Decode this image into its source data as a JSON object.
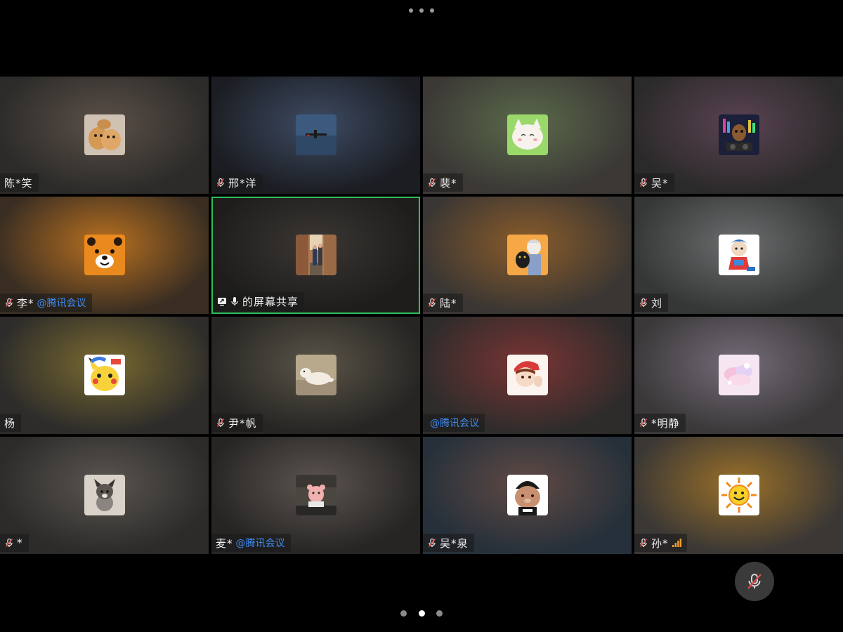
{
  "more_menu": {
    "icon": "more-dots-icon"
  },
  "tiles": [
    {
      "name": "陈*笑",
      "org": "",
      "mic": "none",
      "avatar": "cats-photo",
      "bg": [
        "#5b5048",
        "#2c2b29"
      ]
    },
    {
      "name": "邢*洋",
      "org": "",
      "mic": "muted",
      "avatar": "plane-photo",
      "bg": [
        "#3e4b63",
        "#1b1d22"
      ]
    },
    {
      "name": "裴*",
      "org": "",
      "mic": "muted",
      "avatar": "cat-cartoon",
      "bg": [
        "#5a6a4a",
        "#3b3836"
      ]
    },
    {
      "name": "吴*",
      "org": "",
      "mic": "muted",
      "avatar": "groot-dj",
      "bg": [
        "#5a4352",
        "#2b2a2a"
      ]
    },
    {
      "name": "李*",
      "org": "@腾讯会议",
      "mic": "muted",
      "avatar": "bear-orange",
      "bg": [
        "#b87020",
        "#3a2e22"
      ]
    },
    {
      "name": "的屏幕共享",
      "org": "",
      "mic": "active",
      "avatar": "street-photo",
      "bg": [
        "#3a3633",
        "#1e1d1c"
      ],
      "active": true
    },
    {
      "name": "陆*",
      "org": "",
      "mic": "muted",
      "avatar": "anime-cat",
      "bg": [
        "#8a5c2a",
        "#3a3633"
      ]
    },
    {
      "name": "刘",
      "org": "",
      "mic": "muted",
      "avatar": "mascot-blue",
      "bg": [
        "#6b6d6e",
        "#353636"
      ]
    },
    {
      "name": "杨",
      "org": "",
      "mic": "none",
      "avatar": "pikachu",
      "bg": [
        "#7a6a30",
        "#2d2c2a"
      ]
    },
    {
      "name": "尹*帆",
      "org": "",
      "mic": "muted",
      "avatar": "dog-photo",
      "bg": [
        "#5a5448",
        "#262523"
      ]
    },
    {
      "name": "",
      "org": "@腾讯会议",
      "mic": "none",
      "avatar": "anime-boy",
      "bg": [
        "#7a3434",
        "#2e2c2b"
      ]
    },
    {
      "name": "*明静",
      "org": "",
      "mic": "muted",
      "avatar": "pink-art",
      "bg": [
        "#746c78",
        "#3a3839"
      ]
    },
    {
      "name": "*",
      "org": "",
      "mic": "muted",
      "avatar": "puppy-photo",
      "bg": [
        "#5a5550",
        "#2c2b2a"
      ]
    },
    {
      "name": "麦*",
      "org": "@腾讯会议",
      "mic": "none",
      "avatar": "toy-photo",
      "bg": [
        "#5c5450",
        "#262524"
      ]
    },
    {
      "name": "吴*泉",
      "org": "",
      "mic": "muted",
      "avatar": "bear-cartoon",
      "bg": [
        "#604a44",
        "#26303a"
      ]
    },
    {
      "name": "孙*",
      "org": "",
      "mic": "muted",
      "avatar": "sun-emoji",
      "bg": [
        "#9a7028",
        "#3a3735"
      ],
      "signal": true
    }
  ],
  "mic_button": {
    "icon": "mic-off-icon"
  },
  "pager": {
    "current": 2,
    "total": 3
  },
  "colors": {
    "active_border": "#2fbf5b",
    "org_blue": "#3d8cf0",
    "mute_red": "#e34848",
    "signal_orange": "#f0a030"
  }
}
